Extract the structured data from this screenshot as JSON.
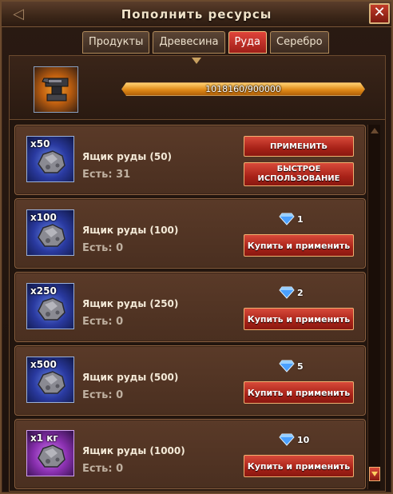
{
  "window": {
    "title": "Пополнить ресурсы",
    "close_label": "✕",
    "back_icon": "chevron-left-icon"
  },
  "tabs": [
    {
      "label": "Продукты",
      "active": false
    },
    {
      "label": "Древесина",
      "active": false
    },
    {
      "label": "Руда",
      "active": true
    },
    {
      "label": "Серебро",
      "active": false
    }
  ],
  "resource": {
    "icon": "anvil-icon",
    "progress_text": "1018160/900000",
    "progress_fraction": 1.0
  },
  "items": [
    {
      "qty": "x50",
      "name": "Ящик руды (50)",
      "count": "Есть: 31",
      "owned": true,
      "apply_label": "ПРИМЕНИТЬ",
      "quick_label": "БЫСТРОЕ ИСПОЛЬЗОВАНИЕ",
      "rarity": "blue"
    },
    {
      "qty": "x100",
      "name": "Ящик руды (100)",
      "count": "Есть: 0",
      "owned": false,
      "price": "1",
      "buy_label": "Купить и применить",
      "rarity": "blue"
    },
    {
      "qty": "x250",
      "name": "Ящик руды (250)",
      "count": "Есть: 0",
      "owned": false,
      "price": "2",
      "buy_label": "Купить и применить",
      "rarity": "blue"
    },
    {
      "qty": "x500",
      "name": "Ящик руды (500)",
      "count": "Есть: 0",
      "owned": false,
      "price": "5",
      "buy_label": "Купить и применить",
      "rarity": "blue"
    },
    {
      "qty": "x1 кг",
      "name": "Ящик руды (1000)",
      "count": "Есть: 0",
      "owned": false,
      "price": "10",
      "buy_label": "Купить и применить",
      "rarity": "purple"
    }
  ],
  "icons": {
    "gem": "diamond-icon",
    "ore": "ore-rock-icon"
  },
  "colors": {
    "accent_red": "#c23a28",
    "gold": "#e08a18",
    "gem_blue": "#4aa0ff"
  }
}
